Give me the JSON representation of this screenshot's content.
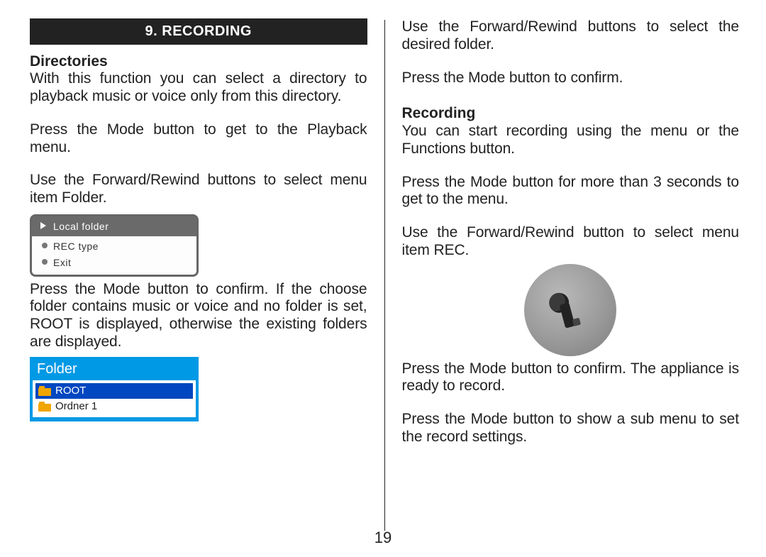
{
  "page_number": "19",
  "left": {
    "chapter": "9. RECORDING",
    "h_directories": "Directories",
    "p1": "With this function you can select a directory to playback music or voice only from this directory.",
    "p2": "Press the Mode button to get to the Playback menu.",
    "p3": "Use the Forward/Rewind buttons to select menu item Folder.",
    "menu1": {
      "selected": "Local folder",
      "item1": "REC type",
      "item2": "Exit"
    },
    "p4": "Press the Mode button to confirm. If the choose folder contains music or voice and no folder is set, ROOT is displayed, otherwise the existing folders are displayed.",
    "menu2": {
      "title": "Folder",
      "selected": "ROOT",
      "item1": "Ordner 1"
    }
  },
  "right": {
    "p1": "Use the Forward/Rewind buttons to select the desired folder.",
    "p2": "Press the Mode button to confirm.",
    "h_recording": "Recording",
    "p3": "You can start recording using the menu or the Functions button.",
    "p4": "Press the Mode button for more than 3 seconds to get to the menu.",
    "p5": "Use the Forward/Rewind button to select menu item REC.",
    "p6": "Press the Mode button to confirm. The appliance is ready to record.",
    "p7": "Press the Mode button to show a sub menu to set the record settings."
  }
}
